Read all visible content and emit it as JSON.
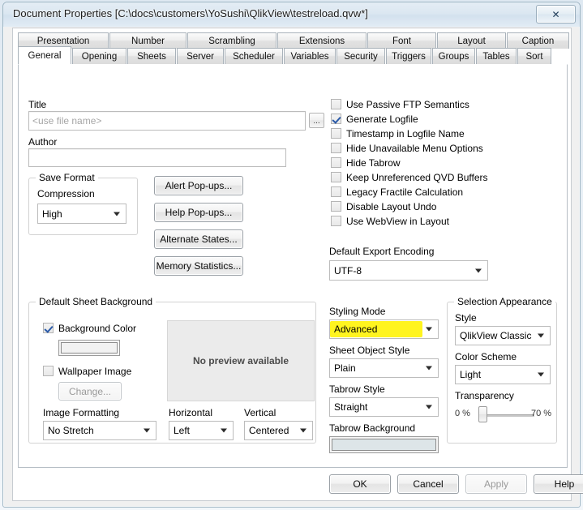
{
  "window": {
    "title": "Document Properties [C:\\docs\\customers\\YoSushi\\QlikView\\testreload.qvw*]",
    "close_glyph": "✕"
  },
  "tabs": {
    "row1": [
      "Presentation",
      "Number",
      "Scrambling",
      "Extensions",
      "Font",
      "Layout",
      "Caption"
    ],
    "row2": [
      "General",
      "Opening",
      "Sheets",
      "Server",
      "Scheduler",
      "Variables",
      "Security",
      "Triggers",
      "Groups",
      "Tables",
      "Sort"
    ],
    "selected": "General"
  },
  "general": {
    "title_label": "Title",
    "title_value": "<use file name>",
    "title_browse": "...",
    "author_label": "Author",
    "author_value": "",
    "save_format": {
      "group_label": "Save Format",
      "compression_label": "Compression",
      "compression_value": "High"
    },
    "buttons": [
      "Alert Pop-ups...",
      "Help Pop-ups...",
      "Alternate States...",
      "Memory Statistics..."
    ],
    "checkboxes": [
      {
        "label": "Use Passive FTP Semantics",
        "checked": false
      },
      {
        "label": "Generate Logfile",
        "checked": true
      },
      {
        "label": "Timestamp in Logfile Name",
        "checked": false
      },
      {
        "label": "Hide Unavailable Menu Options",
        "checked": false
      },
      {
        "label": "Hide Tabrow",
        "checked": false
      },
      {
        "label": "Keep Unreferenced QVD Buffers",
        "checked": false
      },
      {
        "label": "Legacy Fractile Calculation",
        "checked": false
      },
      {
        "label": "Disable Layout Undo",
        "checked": false
      },
      {
        "label": "Use WebView in Layout",
        "checked": false
      }
    ],
    "export_encoding_label": "Default Export Encoding",
    "export_encoding_value": "UTF-8"
  },
  "sheet_background": {
    "group_label": "Default Sheet Background",
    "background_color_label": "Background Color",
    "background_color_checked": true,
    "background_color_value": "#f2f2f2",
    "wallpaper_label": "Wallpaper Image",
    "wallpaper_checked": false,
    "change_button": "Change...",
    "preview_text": "No preview available",
    "image_formatting_label": "Image Formatting",
    "image_formatting_value": "No Stretch",
    "horizontal_label": "Horizontal",
    "horizontal_value": "Left",
    "vertical_label": "Vertical",
    "vertical_value": "Centered"
  },
  "styling": {
    "styling_mode_label": "Styling Mode",
    "styling_mode_value": "Advanced",
    "styling_mode_highlight_color": "#fff200",
    "sheet_object_style_label": "Sheet Object Style",
    "sheet_object_style_value": "Plain",
    "tabrow_style_label": "Tabrow Style",
    "tabrow_style_value": "Straight",
    "tabrow_background_label": "Tabrow Background",
    "tabrow_background_color": "#dde5e8"
  },
  "selection_appearance": {
    "group_label": "Selection Appearance",
    "style_label": "Style",
    "style_value": "QlikView Classic",
    "color_scheme_label": "Color Scheme",
    "color_scheme_value": "Light",
    "transparency_label": "Transparency",
    "transparency_min": "0 %",
    "transparency_max": "70 %"
  },
  "footer": {
    "ok": "OK",
    "cancel": "Cancel",
    "apply": "Apply",
    "help": "Help"
  }
}
